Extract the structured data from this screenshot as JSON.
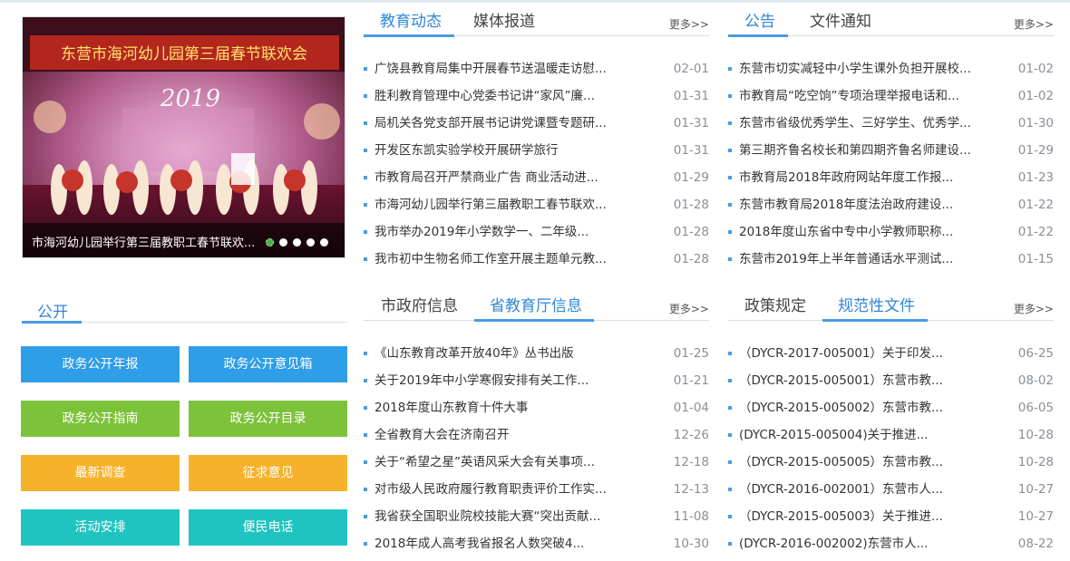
{
  "slider": {
    "banner_text": "东营市海河幼儿园第三届春节联欢会",
    "year_text": "2019",
    "caption": "市海河幼儿园举行第三届教职工春节联欢...",
    "dots_count": 5,
    "active_dot": 0
  },
  "panels": {
    "education": {
      "tabs": [
        "教育动态",
        "媒体报道"
      ],
      "active_tab": 0,
      "more": "更多>>",
      "items": [
        {
          "title": "广饶县教育局集中开展春节送温暖走访慰...",
          "date": "02-01"
        },
        {
          "title": "胜利教育管理中心党委书记讲“家风”廉...",
          "date": "01-31"
        },
        {
          "title": "局机关各党支部开展书记讲党课暨专题研...",
          "date": "01-31"
        },
        {
          "title": "开发区东凯实验学校开展研学旅行",
          "date": "01-31"
        },
        {
          "title": "市教育局召开严禁商业广告 商业活动进...",
          "date": "01-29"
        },
        {
          "title": "市海河幼儿园举行第三届教职工春节联欢...",
          "date": "01-28"
        },
        {
          "title": "我市举办2019年小学数学一、二年级...",
          "date": "01-28"
        },
        {
          "title": "我市初中生物名师工作室开展主题单元教...",
          "date": "01-28"
        }
      ]
    },
    "notice": {
      "tabs": [
        "公告",
        "文件通知"
      ],
      "active_tab": 0,
      "more": "更多>>",
      "items": [
        {
          "title": "东营市切实减轻中小学生课外负担开展校...",
          "date": "01-02"
        },
        {
          "title": "市教育局“吃空饷”专项治理举报电话和...",
          "date": "01-02"
        },
        {
          "title": "东营市省级优秀学生、三好学生、优秀学...",
          "date": "01-30"
        },
        {
          "title": "第三期齐鲁名校长和第四期齐鲁名师建设...",
          "date": "01-29"
        },
        {
          "title": "市教育局2018年政府网站年度工作报...",
          "date": "01-23"
        },
        {
          "title": "东营市教育局2018年度法治政府建设...",
          "date": "01-22"
        },
        {
          "title": "2018年度山东省中专中小学教师职称...",
          "date": "01-22"
        },
        {
          "title": "东营市2019年上半年普通话水平测试...",
          "date": "01-15"
        }
      ]
    },
    "gov": {
      "tabs": [
        "市政府信息",
        "省教育厅信息"
      ],
      "active_tab": 1,
      "more": "更多>>",
      "items": [
        {
          "title": "《山东教育改革开放40年》丛书出版",
          "date": "01-25"
        },
        {
          "title": "关于2019年中小学寒假安排有关工作...",
          "date": "01-21"
        },
        {
          "title": "2018年度山东教育十件大事",
          "date": "01-04"
        },
        {
          "title": "全省教育大会在济南召开",
          "date": "12-26"
        },
        {
          "title": "关于“希望之星”英语风采大会有关事项...",
          "date": "12-18"
        },
        {
          "title": "对市级人民政府履行教育职责评价工作实...",
          "date": "12-13"
        },
        {
          "title": "我省获全国职业院校技能大赛“突出贡献...",
          "date": "11-08"
        },
        {
          "title": "2018年成人高考我省报名人数突破4...",
          "date": "10-30"
        }
      ]
    },
    "policy": {
      "tabs": [
        "政策规定",
        "规范性文件"
      ],
      "active_tab": 1,
      "more": "更多>>",
      "items": [
        {
          "title": "（DYCR-2017-005001）关于印发...",
          "date": "06-25"
        },
        {
          "title": "（DYCR-2015-005001）东营市教...",
          "date": "08-02"
        },
        {
          "title": "（DYCR-2015-005002）东营市教...",
          "date": "06-05"
        },
        {
          "title": "(DYCR-2015-005004)关于推进...",
          "date": "10-28"
        },
        {
          "title": "（DYCR-2015-005005）东营市教...",
          "date": "10-28"
        },
        {
          "title": "（DYCR-2016-002001）东营市人...",
          "date": "10-27"
        },
        {
          "title": "（DYCR-2015-005003）关于推进...",
          "date": "10-27"
        },
        {
          "title": "(DYCR-2016-002002)东营市人...",
          "date": "08-22"
        }
      ]
    }
  },
  "public": {
    "title": "公开",
    "buttons": [
      {
        "label": "政务公开年报",
        "color": "#2e9ee8"
      },
      {
        "label": "政务公开意见箱",
        "color": "#2e9ee8"
      },
      {
        "label": "政务公开指南",
        "color": "#7cc23a"
      },
      {
        "label": "政务公开目录",
        "color": "#7cc23a"
      },
      {
        "label": "最新调查",
        "color": "#f6b22b"
      },
      {
        "label": "征求意见",
        "color": "#f6b22b"
      },
      {
        "label": "活动安排",
        "color": "#1fc4c0"
      },
      {
        "label": "便民电话",
        "color": "#1fc4c0"
      }
    ]
  },
  "colors": {
    "accent": "#2e87d8",
    "underline": "#4b9be0"
  }
}
